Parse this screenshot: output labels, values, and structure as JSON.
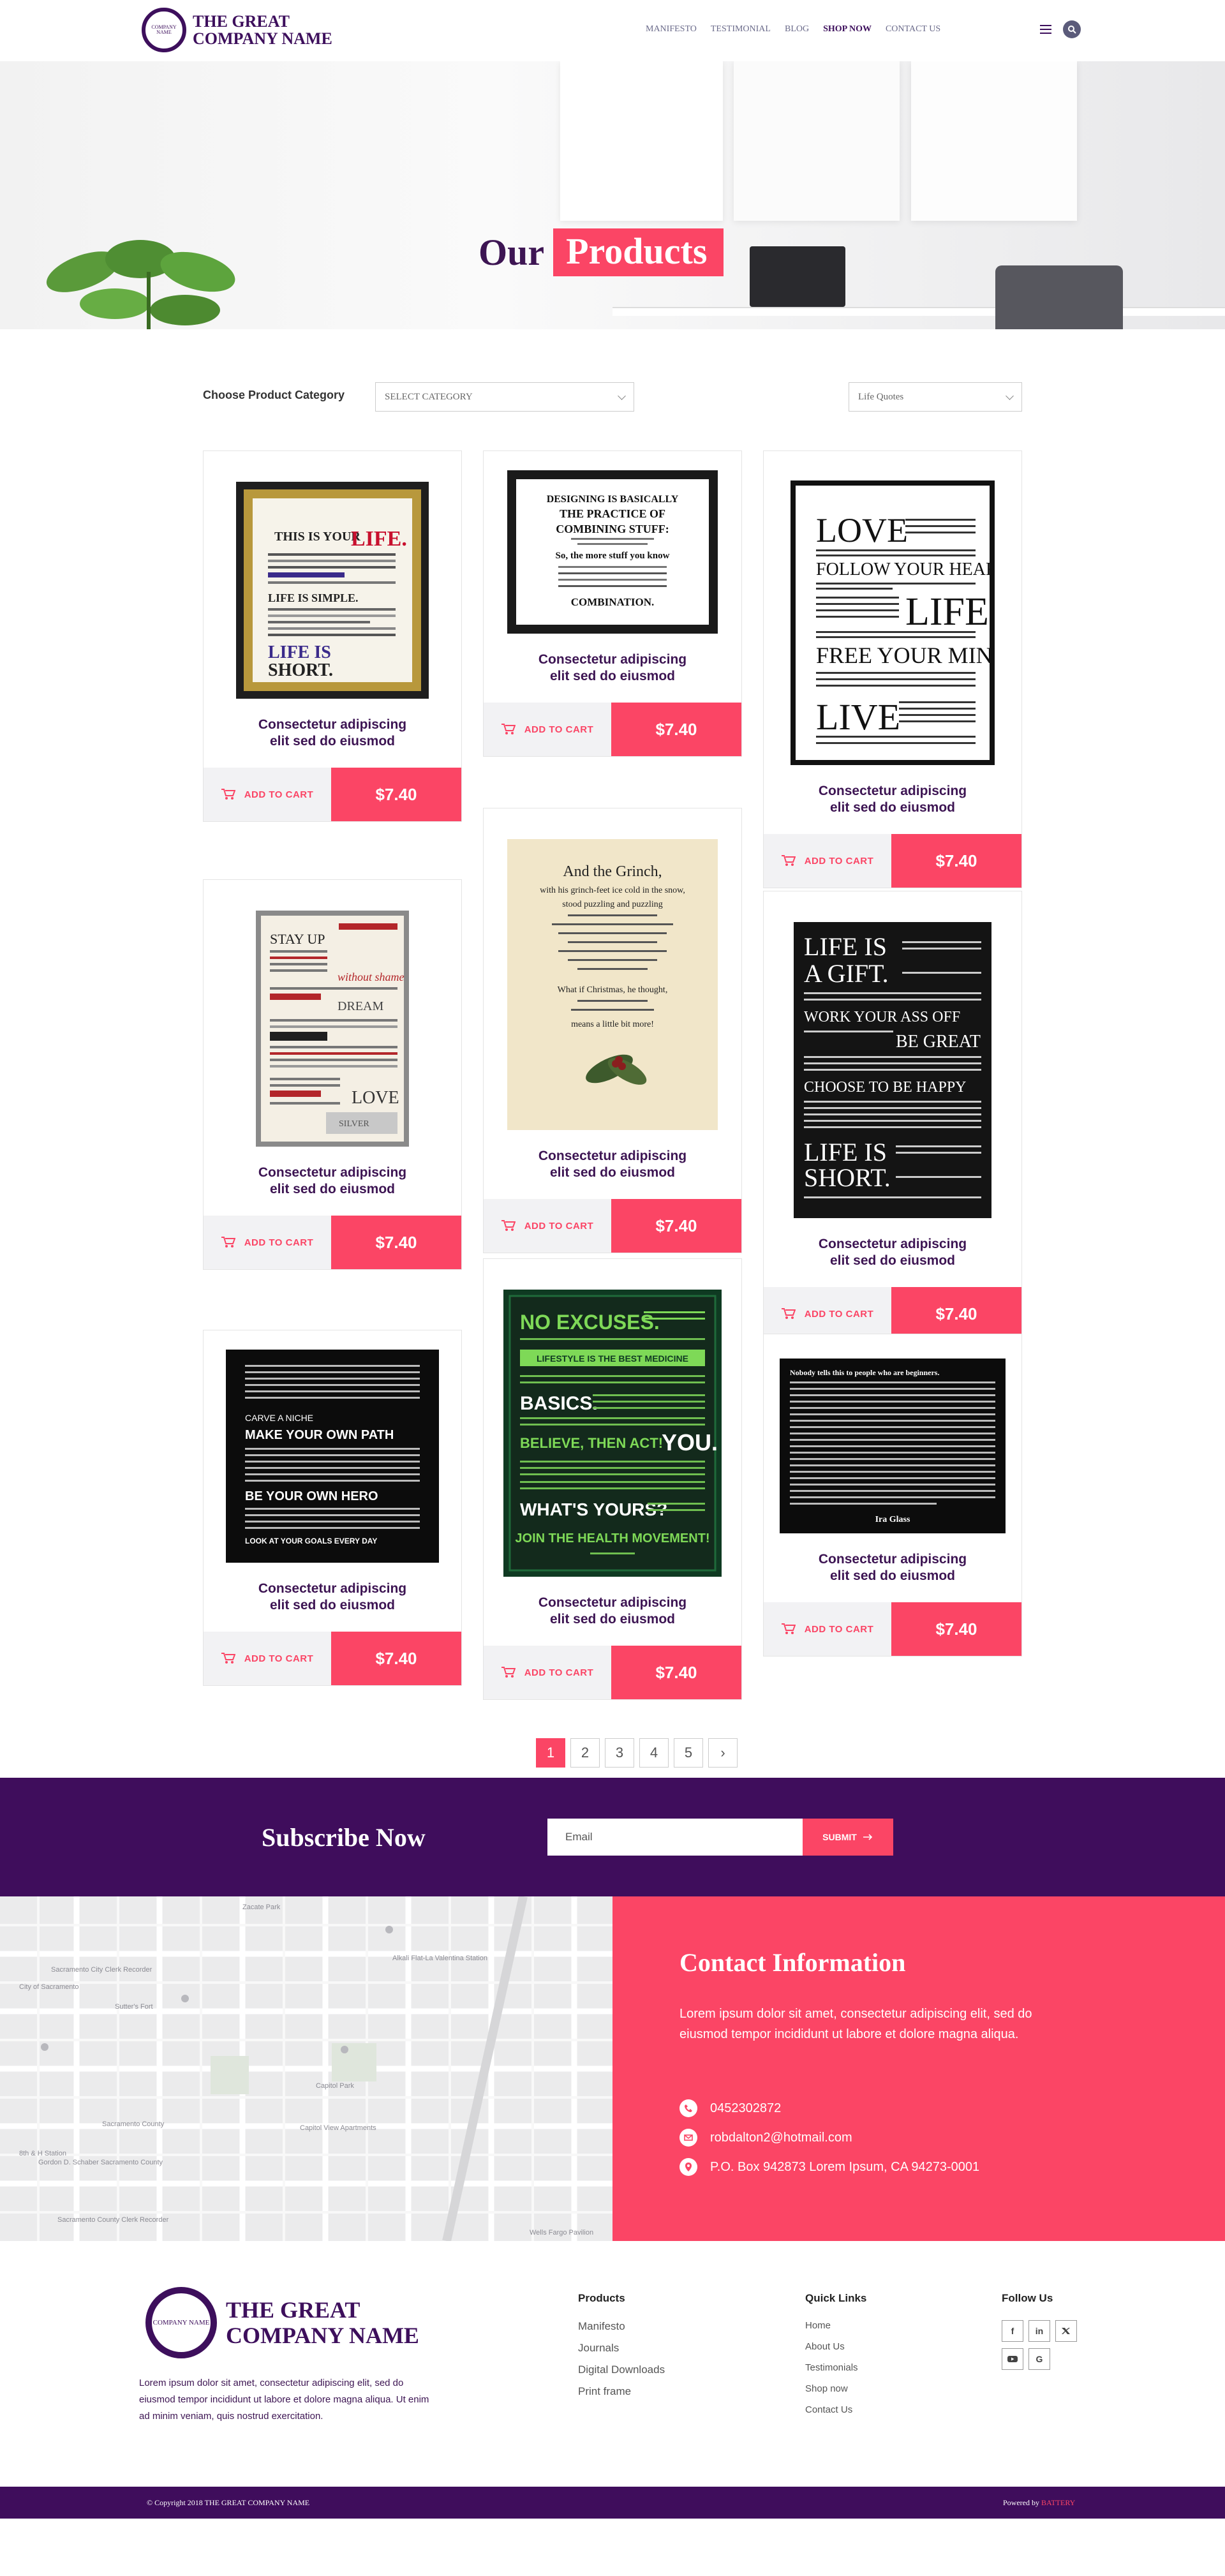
{
  "brand": {
    "badge_text": "COMPANY NAME",
    "line1": "THE GREAT",
    "line2": "COMPANY NAME"
  },
  "nav": [
    {
      "label": "MANIFESTO",
      "active": false
    },
    {
      "label": "TESTIMONIAL",
      "active": false
    },
    {
      "label": "BLOG",
      "active": false
    },
    {
      "label": "SHOP NOW",
      "active": true
    },
    {
      "label": "CONTACT US",
      "active": false
    }
  ],
  "hero": {
    "title_plain": "Our",
    "title_highlight": "Products"
  },
  "filter": {
    "label": "Choose Product Category",
    "category_value": "SELECT CATEGORY",
    "subcategory_value": "Life Quotes"
  },
  "products": {
    "add_to_cart_label": "ADD TO CART",
    "items": [
      {
        "caption1": "Consectetur adipiscing",
        "caption2": "elit sed do eiusmod",
        "price": "$7.40"
      },
      {
        "caption1": "Consectetur adipiscing",
        "caption2": "elit sed do eiusmod",
        "price": "$7.40"
      },
      {
        "caption1": "Consectetur adipiscing",
        "caption2": "elit sed do eiusmod",
        "price": "$7.40"
      },
      {
        "caption1": "Consectetur adipiscing",
        "caption2": "elit sed do eiusmod",
        "price": "$7.40"
      },
      {
        "caption1": "Consectetur adipiscing",
        "caption2": "elit sed do eiusmod",
        "price": "$7.40"
      },
      {
        "caption1": "Consectetur adipiscing",
        "caption2": "elit sed do eiusmod",
        "price": "$7.40"
      },
      {
        "caption1": "Consectetur adipiscing",
        "caption2": "elit sed do eiusmod",
        "price": "$7.40"
      },
      {
        "caption1": "Consectetur adipiscing",
        "caption2": "elit sed do eiusmod",
        "price": "$7.40"
      },
      {
        "caption1": "Consectetur adipiscing",
        "caption2": "elit sed do eiusmod",
        "price": "$7.40"
      }
    ]
  },
  "posters": {
    "p1": {
      "l1": "THIS IS YOUR",
      "l2": "LIFE.",
      "l3": "LIFE IS SIMPLE.",
      "l4": "LIFE IS",
      "l5": "SHORT."
    },
    "p2": {
      "l1": "DESIGNING IS BASICALLY",
      "l2": "THE PRACTICE OF",
      "l3": "COMBINING STUFF:",
      "l4": "So, the more stuff you know",
      "l5": "COMBINATION."
    },
    "p3": {
      "l1": "LOVE",
      "l2": "FOLLOW YOUR HEART",
      "l3": "LIFE",
      "l4": "FREE YOUR MIND",
      "l5": "LIVE"
    },
    "p4": {
      "l1": "STAY UP",
      "l2": "without shame",
      "l3": "DREAM",
      "l4": "LOVE",
      "l5": "SILVER"
    },
    "p5": {
      "l1": "And the Grinch,",
      "l2": "with his grinch-feet ice cold in the snow,",
      "l3": "stood puzzling and puzzling",
      "l4": "What if Christmas, he thought,",
      "l5": "means a little bit more!"
    },
    "p6": {
      "l1": "LIFE IS",
      "l2": "A GIFT.",
      "l3": "WORK YOUR ASS OFF",
      "l4": "BE GREAT",
      "l5": "CHOOSE TO BE HAPPY",
      "l6": "LIFE IS",
      "l7": "SHORT."
    },
    "p7": {
      "l1": "MAKE YOUR OWN PATH",
      "l2": "CARVE A NICHE",
      "l3": "BE YOUR OWN HERO",
      "l4": "LOOK AT YOUR GOALS EVERY DAY"
    },
    "p8": {
      "l1": "NO EXCUSES.",
      "l2": "LIFESTYLE IS THE BEST MEDICINE",
      "l3": "BASICS.",
      "l4": "BELIEVE, THEN ACT!",
      "l5": "YOU.",
      "l6": "WHAT'S YOURS?",
      "l7": "JOIN THE HEALTH MOVEMENT!"
    },
    "p9": {
      "l1": "Nobody tells this to people who are beginners.",
      "l2": "Ira Glass"
    }
  },
  "pagination": {
    "pages": [
      "1",
      "2",
      "3",
      "4",
      "5"
    ],
    "next": "›"
  },
  "subscribe": {
    "title": "Subscribe Now",
    "placeholder": "Email",
    "button": "SUBMIT"
  },
  "contact": {
    "title": "Contact Information",
    "lead": "Lorem ipsum dolor sit amet, consectetur adipiscing elit, sed do eiusmod tempor incididunt ut labore et dolore magna aliqua.",
    "phone": "0452302872",
    "email": "robdalton2@hotmail.com",
    "address": "P.O. Box 942873 Lorem Ipsum, CA 94273-0001"
  },
  "map_labels": [
    "Zacate Park",
    "Sacramento City Clerk Recorder",
    "Sutter's Fort",
    "Alkali Flat-La Valentina Station",
    "Capitol Park",
    "Sacramento County",
    "Capitol View Apartments",
    "Gordon D. Schaber Sacramento County",
    "Sacramento County Clerk Recorder",
    "Wells Fargo Pavilion",
    "City of Sacramento",
    "8th & H Station"
  ],
  "footer": {
    "about": "Lorem ipsum dolor sit amet, consectetur adipiscing elit, sed do eiusmod tempor incididunt ut labore et dolore magna aliqua. Ut enim ad minim veniam, quis nostrud exercitation.",
    "products_title": "Products",
    "products_links": [
      "Manifesto",
      "Journals",
      "Digital Downloads",
      "Print frame"
    ],
    "quick_title": "Quick Links",
    "quick_links": [
      "Home",
      "About Us",
      "Testimonials",
      "Shop now",
      "Contact Us"
    ],
    "follow_title": "Follow Us",
    "socials": [
      "f",
      "in",
      "t",
      "yt",
      "G"
    ],
    "copyright": "© Copyright 2018 THE GREAT COMPANY NAME",
    "powered_prefix": "Powered by",
    "powered_brand": "BATTERY"
  },
  "colors": {
    "accent": "#fb4565",
    "brand": "#3f0d5c",
    "title": "#3d1553"
  }
}
